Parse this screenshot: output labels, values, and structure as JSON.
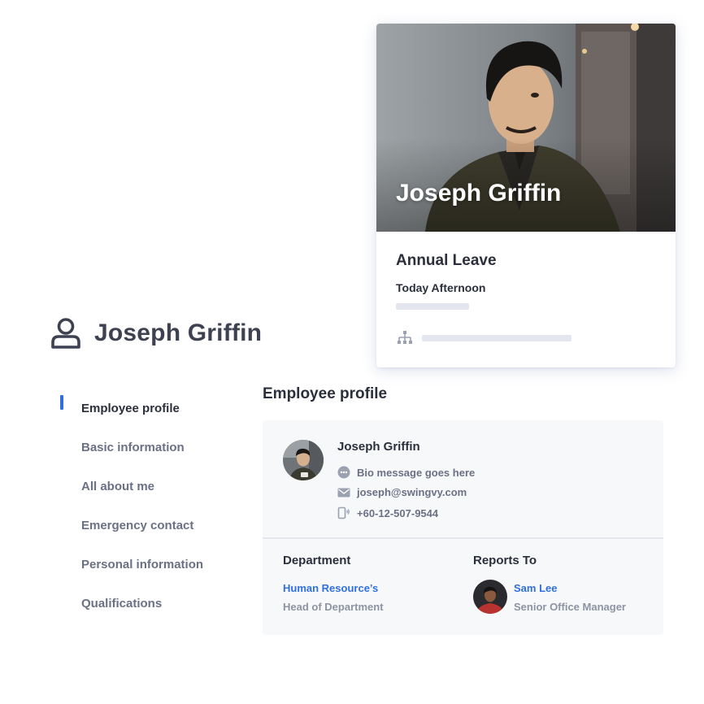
{
  "page": {
    "title": "Joseph Griffin",
    "icon": "user-icon"
  },
  "nav": {
    "items": [
      {
        "label": "Employee profile",
        "active": true
      },
      {
        "label": "Basic information",
        "active": false
      },
      {
        "label": "All about me",
        "active": false
      },
      {
        "label": "Emergency contact",
        "active": false
      },
      {
        "label": "Personal information",
        "active": false
      },
      {
        "label": "Qualifications",
        "active": false
      }
    ],
    "accent_color": "#2f6fe0"
  },
  "profile": {
    "section_title": "Employee profile",
    "name": "Joseph Griffin",
    "bio": "Bio message goes here",
    "email": "joseph@swingvy.com",
    "phone": "+60-12-507-9544",
    "department": {
      "label": "Department",
      "name": "Human Resource’s",
      "role": "Head of Department"
    },
    "reports_to": {
      "label": "Reports To",
      "name": "Sam Lee",
      "role": "Senior Office Manager"
    }
  },
  "card": {
    "name": "Joseph Griffin",
    "title": "Annual Leave",
    "subtitle": "Today Afternoon",
    "icon": "org-chart-icon"
  },
  "colors": {
    "link": "#2f6fe0",
    "text_dark": "#2b2f3c",
    "text_muted": "#6b7184",
    "panel_bg": "#f7f8fa"
  }
}
